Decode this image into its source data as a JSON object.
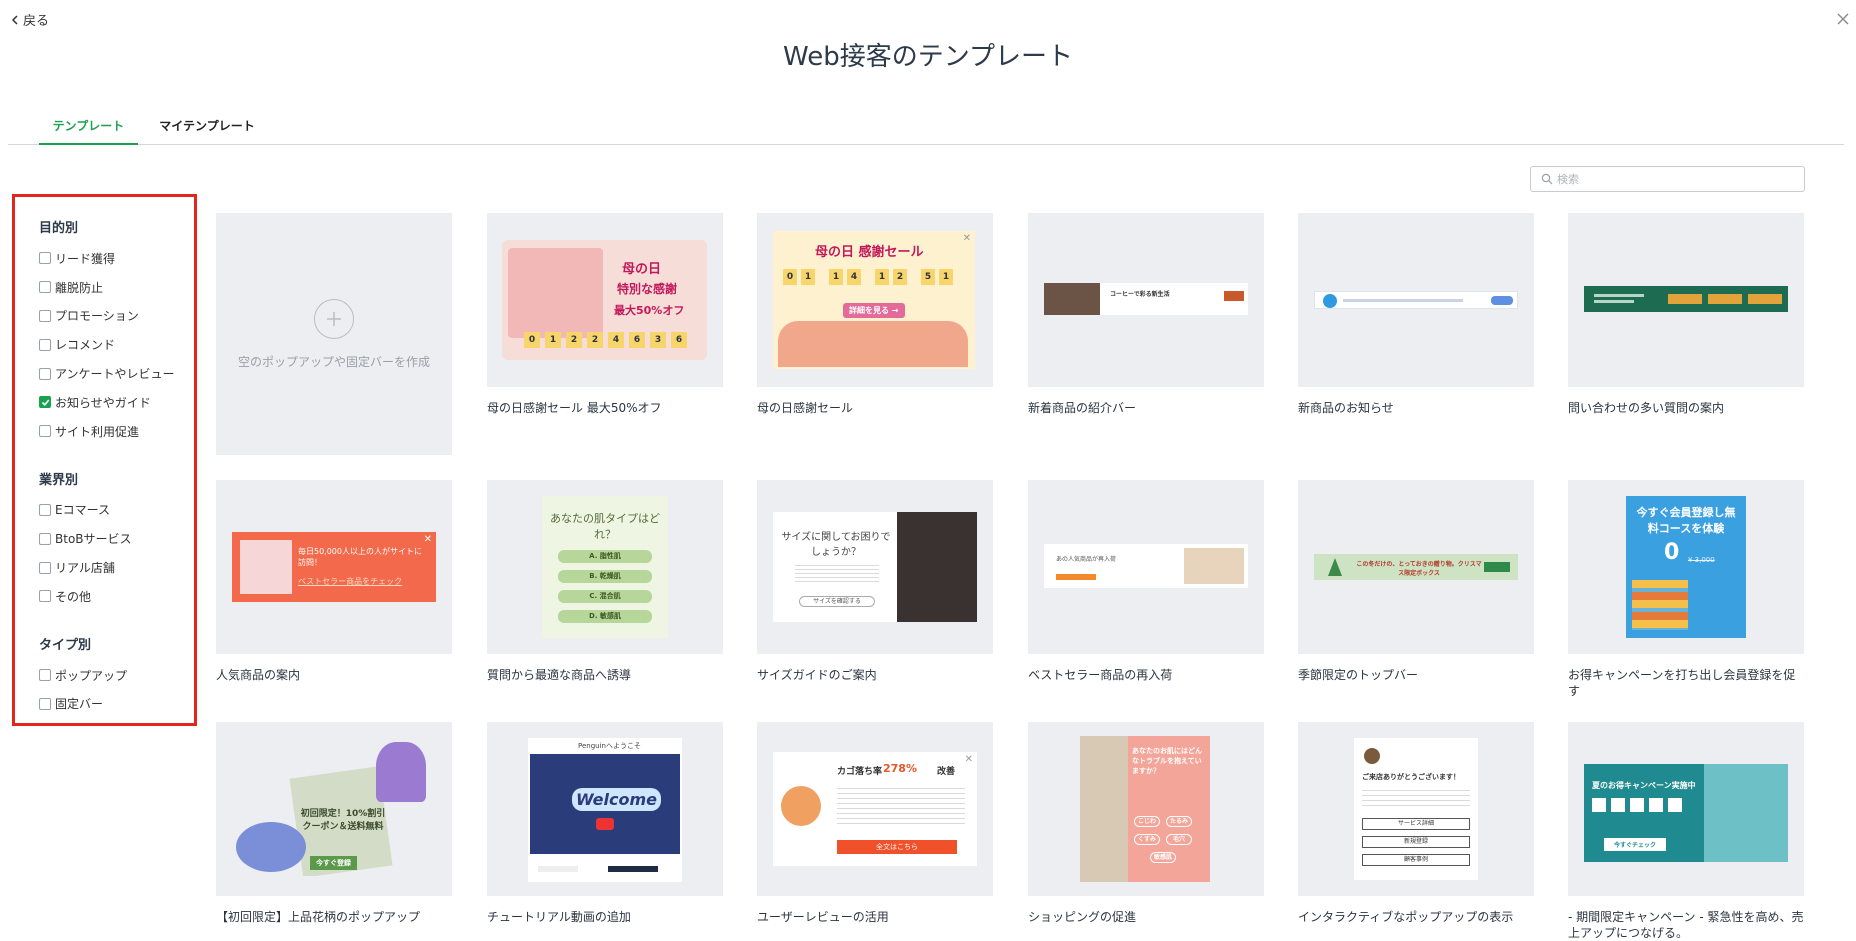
{
  "nav": {
    "back_label": "戻る"
  },
  "page": {
    "title": "Web接客のテンプレート"
  },
  "tabs": [
    {
      "label": "テンプレート",
      "active": true
    },
    {
      "label": "マイテンプレート",
      "active": false
    }
  ],
  "search": {
    "placeholder": "検索",
    "value": ""
  },
  "filters": [
    {
      "heading": "目的別",
      "items": [
        {
          "label": "リード獲得",
          "checked": false
        },
        {
          "label": "離脱防止",
          "checked": false
        },
        {
          "label": "プロモーション",
          "checked": false
        },
        {
          "label": "レコメンド",
          "checked": false
        },
        {
          "label": "アンケートやレビュー",
          "checked": false
        },
        {
          "label": "お知らせやガイド",
          "checked": true
        },
        {
          "label": "サイト利用促進",
          "checked": false
        }
      ]
    },
    {
      "heading": "業界別",
      "items": [
        {
          "label": "Eコマース",
          "checked": false
        },
        {
          "label": "BtoBサービス",
          "checked": false
        },
        {
          "label": "リアル店舗",
          "checked": false
        },
        {
          "label": "その他",
          "checked": false
        }
      ]
    },
    {
      "heading": "タイプ別",
      "items": [
        {
          "label": "ポップアップ",
          "checked": false
        },
        {
          "label": "固定バー",
          "checked": false
        }
      ]
    }
  ],
  "blank_card": {
    "label": "空のポップアップや固定バーを作成"
  },
  "templates": [
    {
      "label": "母の日感謝セール 最大50%オフ",
      "preview": {
        "headline": [
          "母の日",
          "特別な感謝",
          "最大50%オフ"
        ],
        "digits": [
          "0",
          "1",
          "2",
          "2",
          "4",
          "6",
          "3",
          "6"
        ]
      }
    },
    {
      "label": "母の日感謝セール",
      "preview": {
        "headline": "母の日 感謝セール",
        "digits": [
          "0",
          "1",
          "1",
          "4",
          "1",
          "2",
          "5",
          "1"
        ],
        "button": "詳細を見る →"
      }
    },
    {
      "label": "新着商品の紹介バー",
      "preview": {
        "text": "コーヒーで彩る新生活"
      }
    },
    {
      "label": "新商品のお知らせ",
      "preview": {}
    },
    {
      "label": "問い合わせの多い質問の案内",
      "preview": {}
    },
    {
      "label": "人気商品の案内",
      "preview": {
        "text": "毎日50,000人以上の人がサイトに訪問！",
        "link": "ベストセラー商品をチェック"
      }
    },
    {
      "label": "質問から最適な商品へ誘導",
      "preview": {
        "title": "あなたの肌タイプはどれ？",
        "options": [
          "A. 脂性肌",
          "B. 乾燥肌",
          "C. 混合肌",
          "D. 敏感肌"
        ]
      }
    },
    {
      "label": "サイズガイドのご案内",
      "preview": {
        "title": "サイズに関してお困りでしょうか？",
        "button": "サイズを確認する"
      }
    },
    {
      "label": "ベストセラー商品の再入荷",
      "preview": {
        "text": "あの人気商品が再入荷"
      }
    },
    {
      "label": "季節限定のトップバー",
      "preview": {
        "text": "この冬だけの、とっておきの贈り物。クリスマス限定ボックス"
      }
    },
    {
      "label": "お得キャンペーンを打ち出し会員登録を促す",
      "preview": {
        "title": "今すぐ会員登録し無料コースを体験",
        "price": "0",
        "old_price": "¥ 3,000"
      }
    },
    {
      "label": "【初回限定】上品花柄のポップアップ",
      "preview": {
        "text": "初回限定！10%割引クーポン＆送料無料",
        "button": "今すぐ登録"
      }
    },
    {
      "label": "チュートリアル動画の追加",
      "preview": {
        "title": "Penguinへようこそ",
        "video": "Welcome"
      }
    },
    {
      "label": "ユーザーレビューの活用",
      "preview": {
        "title": "カゴ落ち率",
        "percent": "278%",
        "suffix": "改善",
        "button": "全文はこちら"
      }
    },
    {
      "label": "ショッピングの促進",
      "preview": {
        "title": "あなたのお肌にはどんなトラブルを抱えていますか？",
        "options": [
          "こじわ",
          "たるみ",
          "くすみ",
          "毛穴",
          "敏感肌"
        ]
      }
    },
    {
      "label": "インタラクティブなポップアップの表示",
      "preview": {
        "title": "ご来店ありがとうございます！",
        "buttons": [
          "サービス詳細",
          "新規登録",
          "顧客事例"
        ]
      }
    },
    {
      "label": "- 期間限定キャンペーン - 緊急性を高め、売上アップにつなげる。",
      "preview": {
        "title": "夏のお得キャンペーン実施中",
        "button": "今すぐチェック"
      }
    }
  ],
  "colors": {
    "accent": "#1aa251",
    "highlight_border": "#e0261f",
    "card_bg": "#eceef1"
  }
}
